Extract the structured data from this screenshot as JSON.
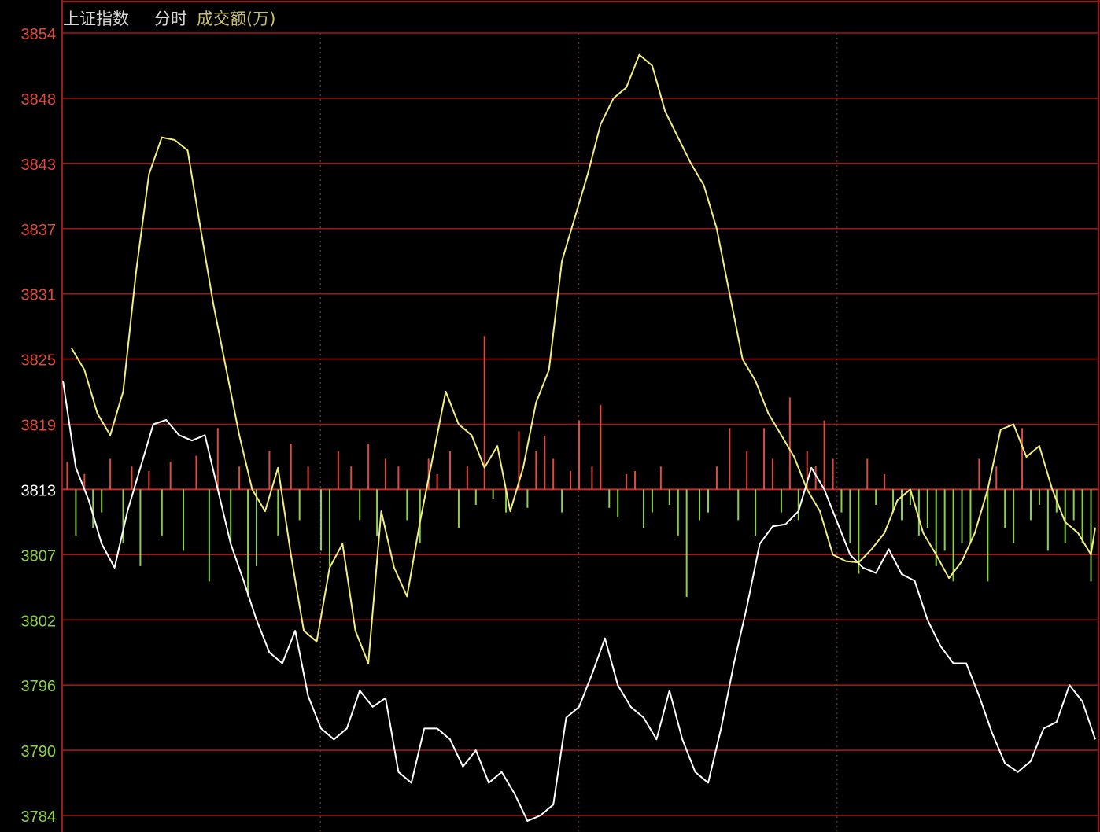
{
  "header": {
    "index_name": "上证指数",
    "mode": "分时",
    "indicator": "成交额(万)"
  },
  "colors": {
    "background": "#000000",
    "grid": "#a01818",
    "baseline": "#e02020",
    "up": "#e04a3a",
    "down": "#8cd048",
    "neutral_label": "#ffffff",
    "index_line": "#ffffff",
    "average_line": "#f2ee80",
    "header_text": "#d8d8d8",
    "indicator_text": "#c8c070"
  },
  "chart_data": {
    "type": "line",
    "title": "",
    "y_ticks": [
      3854,
      3848,
      3843,
      3837,
      3831,
      3825,
      3819,
      3813,
      3807,
      3802,
      3796,
      3790,
      3784
    ],
    "ylim": [
      3784,
      3854
    ],
    "baseline": 3813,
    "x_points": 241,
    "session_dividers": 4,
    "series": [
      {
        "role": "index",
        "values": [
          [
            0,
            3823
          ],
          [
            3,
            3815
          ],
          [
            6,
            3812
          ],
          [
            9,
            3808
          ],
          [
            12,
            3806
          ],
          [
            15,
            3811
          ],
          [
            18,
            3815
          ],
          [
            21,
            3819
          ],
          [
            24,
            3819.4
          ],
          [
            27,
            3818
          ],
          [
            30,
            3817.5
          ],
          [
            33,
            3818
          ],
          [
            36,
            3813
          ],
          [
            39,
            3808
          ],
          [
            42,
            3805
          ],
          [
            45,
            3802
          ],
          [
            48,
            3799
          ],
          [
            51,
            3798
          ],
          [
            54,
            3801
          ],
          [
            57,
            3795
          ],
          [
            60,
            3792
          ],
          [
            63,
            3791
          ],
          [
            66,
            3792
          ],
          [
            69,
            3795.5
          ],
          [
            72,
            3794
          ],
          [
            75,
            3794.8
          ],
          [
            78,
            3788
          ],
          [
            81,
            3787
          ],
          [
            84,
            3792
          ],
          [
            87,
            3792
          ],
          [
            90,
            3791
          ],
          [
            93,
            3788.5
          ],
          [
            96,
            3790
          ],
          [
            99,
            3787
          ],
          [
            102,
            3788
          ],
          [
            105,
            3786
          ],
          [
            108,
            3783.5
          ],
          [
            111,
            3784
          ],
          [
            114,
            3785
          ],
          [
            117,
            3793
          ],
          [
            120,
            3794
          ],
          [
            123,
            3797
          ],
          [
            126,
            3800.3
          ],
          [
            129,
            3796
          ],
          [
            132,
            3794
          ],
          [
            135,
            3793
          ],
          [
            138,
            3791
          ],
          [
            141,
            3795.5
          ],
          [
            144,
            3791
          ],
          [
            147,
            3788
          ],
          [
            150,
            3787
          ],
          [
            153,
            3792
          ],
          [
            156,
            3798
          ],
          [
            159,
            3803
          ],
          [
            162,
            3808
          ],
          [
            165,
            3809.6
          ],
          [
            168,
            3809.8
          ],
          [
            171,
            3811
          ],
          [
            174,
            3815
          ],
          [
            177,
            3813
          ],
          [
            180,
            3810
          ],
          [
            183,
            3807
          ],
          [
            186,
            3806
          ],
          [
            189,
            3805.6
          ],
          [
            192,
            3807.5
          ],
          [
            195,
            3805.5
          ],
          [
            198,
            3805
          ],
          [
            201,
            3802
          ],
          [
            204,
            3799.6
          ],
          [
            207,
            3798
          ],
          [
            210,
            3798
          ],
          [
            213,
            3795
          ],
          [
            216,
            3791.6
          ],
          [
            219,
            3788.8
          ],
          [
            222,
            3788
          ],
          [
            225,
            3789
          ],
          [
            228,
            3792
          ],
          [
            231,
            3792.6
          ],
          [
            234,
            3796
          ],
          [
            237,
            3794.5
          ],
          [
            240,
            3791
          ]
        ]
      },
      {
        "role": "average",
        "values": [
          [
            2,
            3826
          ],
          [
            5,
            3824
          ],
          [
            8,
            3820
          ],
          [
            11,
            3818
          ],
          [
            14,
            3822
          ],
          [
            17,
            3833
          ],
          [
            20,
            3842
          ],
          [
            23,
            3845
          ],
          [
            26,
            3844.8
          ],
          [
            29,
            3844
          ],
          [
            32,
            3837
          ],
          [
            35,
            3830
          ],
          [
            38,
            3824
          ],
          [
            41,
            3818
          ],
          [
            44,
            3813
          ],
          [
            47,
            3811
          ],
          [
            50,
            3815
          ],
          [
            53,
            3807
          ],
          [
            56,
            3801
          ],
          [
            59,
            3800
          ],
          [
            62,
            3806
          ],
          [
            65,
            3808
          ],
          [
            68,
            3801
          ],
          [
            71,
            3798
          ],
          [
            74,
            3811
          ],
          [
            77,
            3806
          ],
          [
            80,
            3803.8
          ],
          [
            83,
            3810
          ],
          [
            86,
            3816
          ],
          [
            89,
            3822
          ],
          [
            92,
            3819
          ],
          [
            95,
            3818
          ],
          [
            98,
            3815
          ],
          [
            101,
            3817
          ],
          [
            104,
            3811
          ],
          [
            107,
            3815
          ],
          [
            110,
            3821
          ],
          [
            113,
            3824
          ],
          [
            116,
            3834
          ],
          [
            119,
            3838
          ],
          [
            122,
            3842
          ],
          [
            125,
            3846
          ],
          [
            128,
            3848
          ],
          [
            131,
            3849
          ],
          [
            134,
            3852
          ],
          [
            137,
            3851
          ],
          [
            140,
            3847
          ],
          [
            143,
            3845
          ],
          [
            146,
            3843
          ],
          [
            149,
            3841
          ],
          [
            152,
            3837
          ],
          [
            155,
            3831
          ],
          [
            158,
            3825
          ],
          [
            161,
            3823
          ],
          [
            164,
            3820
          ],
          [
            167,
            3818
          ],
          [
            170,
            3816
          ],
          [
            173,
            3813
          ],
          [
            176,
            3811
          ],
          [
            179,
            3807
          ],
          [
            182,
            3806.5
          ],
          [
            185,
            3806.4
          ],
          [
            188,
            3807.5
          ],
          [
            191,
            3809
          ],
          [
            194,
            3812
          ],
          [
            197,
            3813
          ],
          [
            200,
            3809
          ],
          [
            203,
            3807
          ],
          [
            206,
            3805.2
          ],
          [
            209,
            3806.5
          ],
          [
            212,
            3809
          ],
          [
            215,
            3813
          ],
          [
            218,
            3818.5
          ],
          [
            221,
            3819
          ],
          [
            224,
            3816
          ],
          [
            227,
            3817
          ],
          [
            230,
            3813
          ],
          [
            233,
            3810
          ],
          [
            236,
            3809
          ],
          [
            239,
            3807
          ],
          [
            240,
            3809.5
          ]
        ]
      }
    ],
    "volume_bars": [
      {
        "i": 1,
        "v": 1.8
      },
      {
        "i": 3,
        "v": -3
      },
      {
        "i": 5,
        "v": 1
      },
      {
        "i": 7,
        "v": -2.5
      },
      {
        "i": 9,
        "v": -1.5
      },
      {
        "i": 11,
        "v": 2
      },
      {
        "i": 14,
        "v": -3.5
      },
      {
        "i": 16,
        "v": 1.5
      },
      {
        "i": 18,
        "v": -5
      },
      {
        "i": 20,
        "v": 1.2
      },
      {
        "i": 23,
        "v": -3
      },
      {
        "i": 25,
        "v": 1.8
      },
      {
        "i": 28,
        "v": -4
      },
      {
        "i": 31,
        "v": 2.2
      },
      {
        "i": 34,
        "v": -6
      },
      {
        "i": 36,
        "v": 4
      },
      {
        "i": 39,
        "v": -3.5
      },
      {
        "i": 41,
        "v": 1.5
      },
      {
        "i": 43,
        "v": -7
      },
      {
        "i": 45,
        "v": -5
      },
      {
        "i": 48,
        "v": 2.5
      },
      {
        "i": 50,
        "v": -3
      },
      {
        "i": 53,
        "v": 3
      },
      {
        "i": 55,
        "v": -2
      },
      {
        "i": 57,
        "v": 1.5
      },
      {
        "i": 60,
        "v": -4
      },
      {
        "i": 62,
        "v": -5
      },
      {
        "i": 64,
        "v": 2.5
      },
      {
        "i": 67,
        "v": 1.5
      },
      {
        "i": 69,
        "v": -2
      },
      {
        "i": 71,
        "v": 3
      },
      {
        "i": 73,
        "v": -3
      },
      {
        "i": 75,
        "v": 2
      },
      {
        "i": 78,
        "v": 1.5
      },
      {
        "i": 80,
        "v": -2
      },
      {
        "i": 83,
        "v": -3.5
      },
      {
        "i": 85,
        "v": 2
      },
      {
        "i": 87,
        "v": 1
      },
      {
        "i": 90,
        "v": 2.5
      },
      {
        "i": 92,
        "v": -2.5
      },
      {
        "i": 94,
        "v": 1.5
      },
      {
        "i": 96,
        "v": -1
      },
      {
        "i": 98,
        "v": 10
      },
      {
        "i": 100,
        "v": -0.6
      },
      {
        "i": 103,
        "v": -1.5
      },
      {
        "i": 106,
        "v": 3.8
      },
      {
        "i": 108,
        "v": -1.2
      },
      {
        "i": 110,
        "v": 2.5
      },
      {
        "i": 112,
        "v": 3.5
      },
      {
        "i": 114,
        "v": 2
      },
      {
        "i": 116,
        "v": -1.5
      },
      {
        "i": 118,
        "v": 1.2
      },
      {
        "i": 120,
        "v": 4.5
      },
      {
        "i": 123,
        "v": 1.5
      },
      {
        "i": 125,
        "v": 5.5
      },
      {
        "i": 127,
        "v": -1.2
      },
      {
        "i": 129,
        "v": -1.8
      },
      {
        "i": 131,
        "v": 1
      },
      {
        "i": 133,
        "v": 1.2
      },
      {
        "i": 135,
        "v": -2.5
      },
      {
        "i": 137,
        "v": -1.5
      },
      {
        "i": 139,
        "v": 1.5
      },
      {
        "i": 141,
        "v": -1
      },
      {
        "i": 143,
        "v": -3
      },
      {
        "i": 145,
        "v": -7
      },
      {
        "i": 148,
        "v": -2
      },
      {
        "i": 150,
        "v": -1.5
      },
      {
        "i": 152,
        "v": 1.5
      },
      {
        "i": 155,
        "v": 4
      },
      {
        "i": 157,
        "v": -2
      },
      {
        "i": 159,
        "v": 2.5
      },
      {
        "i": 161,
        "v": -3
      },
      {
        "i": 163,
        "v": 4
      },
      {
        "i": 165,
        "v": 2
      },
      {
        "i": 167,
        "v": -1.5
      },
      {
        "i": 169,
        "v": 6
      },
      {
        "i": 171,
        "v": -2
      },
      {
        "i": 173,
        "v": 2.5
      },
      {
        "i": 175,
        "v": 1.5
      },
      {
        "i": 177,
        "v": 4.5
      },
      {
        "i": 179,
        "v": 2
      },
      {
        "i": 181,
        "v": -1.5
      },
      {
        "i": 183,
        "v": -3.5
      },
      {
        "i": 185,
        "v": -5.5
      },
      {
        "i": 187,
        "v": 2
      },
      {
        "i": 189,
        "v": -1
      },
      {
        "i": 191,
        "v": 1
      },
      {
        "i": 193,
        "v": -1.5
      },
      {
        "i": 195,
        "v": -2
      },
      {
        "i": 197,
        "v": -1
      },
      {
        "i": 199,
        "v": -3
      },
      {
        "i": 201,
        "v": -2.5
      },
      {
        "i": 203,
        "v": -5
      },
      {
        "i": 205,
        "v": -4
      },
      {
        "i": 207,
        "v": -6
      },
      {
        "i": 209,
        "v": -3.5
      },
      {
        "i": 211,
        "v": -3.5
      },
      {
        "i": 213,
        "v": 2
      },
      {
        "i": 215,
        "v": -6
      },
      {
        "i": 217,
        "v": 1.5
      },
      {
        "i": 219,
        "v": -2.5
      },
      {
        "i": 221,
        "v": -3.5
      },
      {
        "i": 223,
        "v": 4
      },
      {
        "i": 225,
        "v": -2
      },
      {
        "i": 227,
        "v": -1
      },
      {
        "i": 229,
        "v": -4
      },
      {
        "i": 231,
        "v": -1.5
      },
      {
        "i": 233,
        "v": -3.5
      },
      {
        "i": 235,
        "v": -2
      },
      {
        "i": 237,
        "v": -3.5
      },
      {
        "i": 239,
        "v": -6
      }
    ]
  }
}
